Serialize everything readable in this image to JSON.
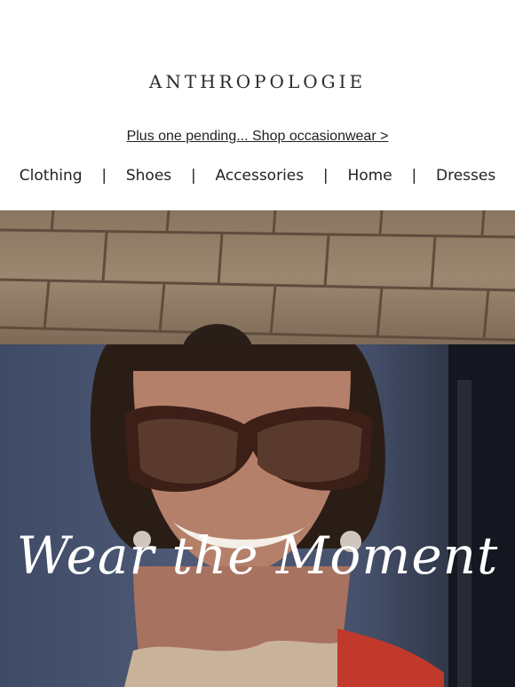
{
  "brand": {
    "logo_text": "ANTHROPOLOGIE"
  },
  "promo": {
    "text": "Plus one pending... Shop occasionwear >"
  },
  "nav": {
    "items": [
      "Clothing",
      "Shoes",
      "Accessories",
      "Home",
      "Dresses"
    ],
    "separator": "|"
  },
  "hero": {
    "caption": "Wear the Moment",
    "image": "woman-smiling-sunglasses"
  },
  "colors": {
    "background": "#ffffff",
    "text": "#222222",
    "wall": "#8f7a64",
    "scene": "#46516b",
    "caption": "#ffffff"
  }
}
